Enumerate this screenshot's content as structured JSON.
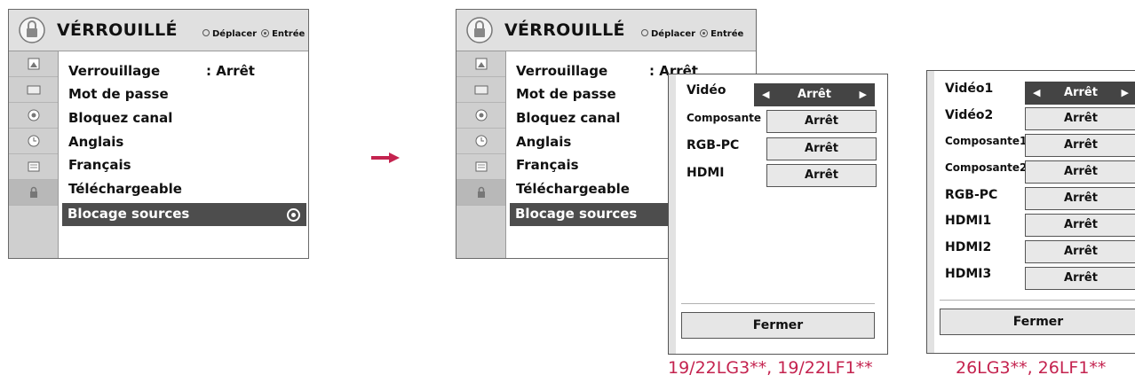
{
  "menu": {
    "title": "VÉRROUILLÉ",
    "hint_move": "Déplacer",
    "hint_enter": "Entrée",
    "items": [
      {
        "label": "Verrouillage",
        "value": ": Arrêt"
      },
      {
        "label": "Mot de passe"
      },
      {
        "label": "Bloquez canal"
      },
      {
        "label": "Anglais"
      },
      {
        "label": "Français"
      },
      {
        "label": "Téléchargeable"
      },
      {
        "label": "Blocage sources",
        "selected": true
      }
    ],
    "sidebar_icons": [
      "picture-icon",
      "tv-screen-icon",
      "audio-icon",
      "clock-icon",
      "option-icon",
      "lock-icon"
    ]
  },
  "popup_small": {
    "rows": [
      {
        "label": "Vidéo",
        "value": "Arrêt",
        "active": true
      },
      {
        "label": "Composante",
        "value": "Arrêt"
      },
      {
        "label": "RGB-PC",
        "value": "Arrêt"
      },
      {
        "label": "HDMI",
        "value": "Arrêt"
      }
    ],
    "close_label": "Fermer",
    "caption": "19/22LG3**, 19/22LF1**"
  },
  "popup_large": {
    "rows": [
      {
        "label": "Vidéo1",
        "value": "Arrêt",
        "active": true
      },
      {
        "label": "Vidéo2",
        "value": "Arrêt"
      },
      {
        "label": "Composante1",
        "value": "Arrêt"
      },
      {
        "label": "Composante2",
        "value": "Arrêt"
      },
      {
        "label": "RGB-PC",
        "value": "Arrêt"
      },
      {
        "label": "HDMI1",
        "value": "Arrêt"
      },
      {
        "label": "HDMI2",
        "value": "Arrêt"
      },
      {
        "label": "HDMI3",
        "value": "Arrêt"
      }
    ],
    "close_label": "Fermer",
    "caption": "26LG3**, 26LF1**"
  },
  "colors": {
    "arrow": "#c4234f",
    "caption": "#c4234f",
    "selection": "#4d4d4d"
  }
}
